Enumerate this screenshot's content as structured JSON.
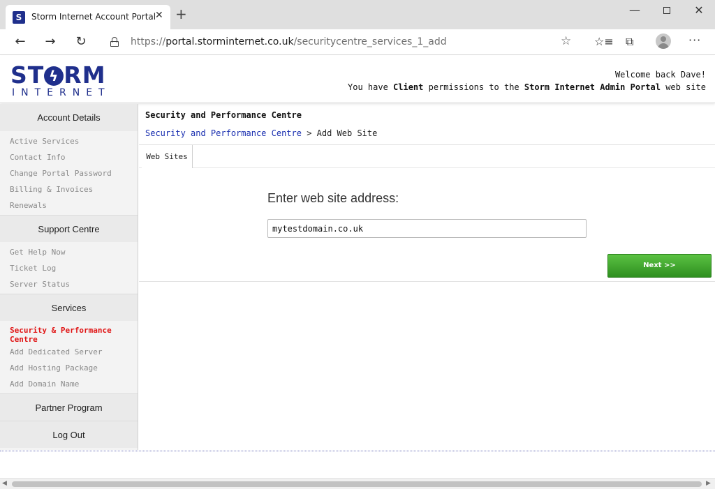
{
  "browser": {
    "tab_favicon": "S",
    "tab_title": "Storm Internet Account Portal",
    "tab_close": "✕",
    "new_tab": "+",
    "win_min": "—",
    "win_close": "✕",
    "nav_back": "←",
    "nav_forward": "→",
    "nav_reload": "↻",
    "url_scheme": "https://",
    "url_host": "portal.storminternet.co.uk",
    "url_path": "/securitycentre_services_1_add",
    "star": "☆",
    "favorites_list": "☆≡",
    "collections": "⧉",
    "more": "···"
  },
  "header": {
    "logo_prefix": "ST",
    "logo_bolt": "ϟ",
    "logo_suffix": "RM",
    "logo_subtitle": "INTERNET",
    "welcome_line": "Welcome back Dave!",
    "perm_1": "You have ",
    "perm_role": "Client",
    "perm_2": " permissions to the ",
    "perm_portal": "Storm Internet Admin Portal",
    "perm_3": " web site"
  },
  "sidebar": {
    "account_details": "Account Details",
    "account_items": [
      "Active Services",
      "Contact Info",
      "Change Portal Password",
      "Billing & Invoices",
      "Renewals"
    ],
    "support_centre": "Support Centre",
    "support_items": [
      "Get Help Now",
      "Ticket Log",
      "Server Status"
    ],
    "services": "Services",
    "services_items": [
      "Security & Performance Centre",
      "Add Dedicated Server",
      "Add Hosting Package",
      "Add Domain Name"
    ],
    "partner_program": "Partner Program",
    "log_out": "Log Out"
  },
  "content": {
    "title": "Security and Performance Centre",
    "breadcrumb_link": "Security and Performance Centre",
    "breadcrumb_sep": " > ",
    "breadcrumb_current": "Add Web Site",
    "tab_websites": "Web Sites",
    "form_label": "Enter web site address:",
    "site_input_value": "mytestdomain.co.uk",
    "next_button": "Next >>"
  },
  "colors": {
    "brand_blue": "#1f2f8c",
    "active_red": "#e01414",
    "link_blue": "#1a2fb0",
    "button_green": "#3fa82c"
  }
}
